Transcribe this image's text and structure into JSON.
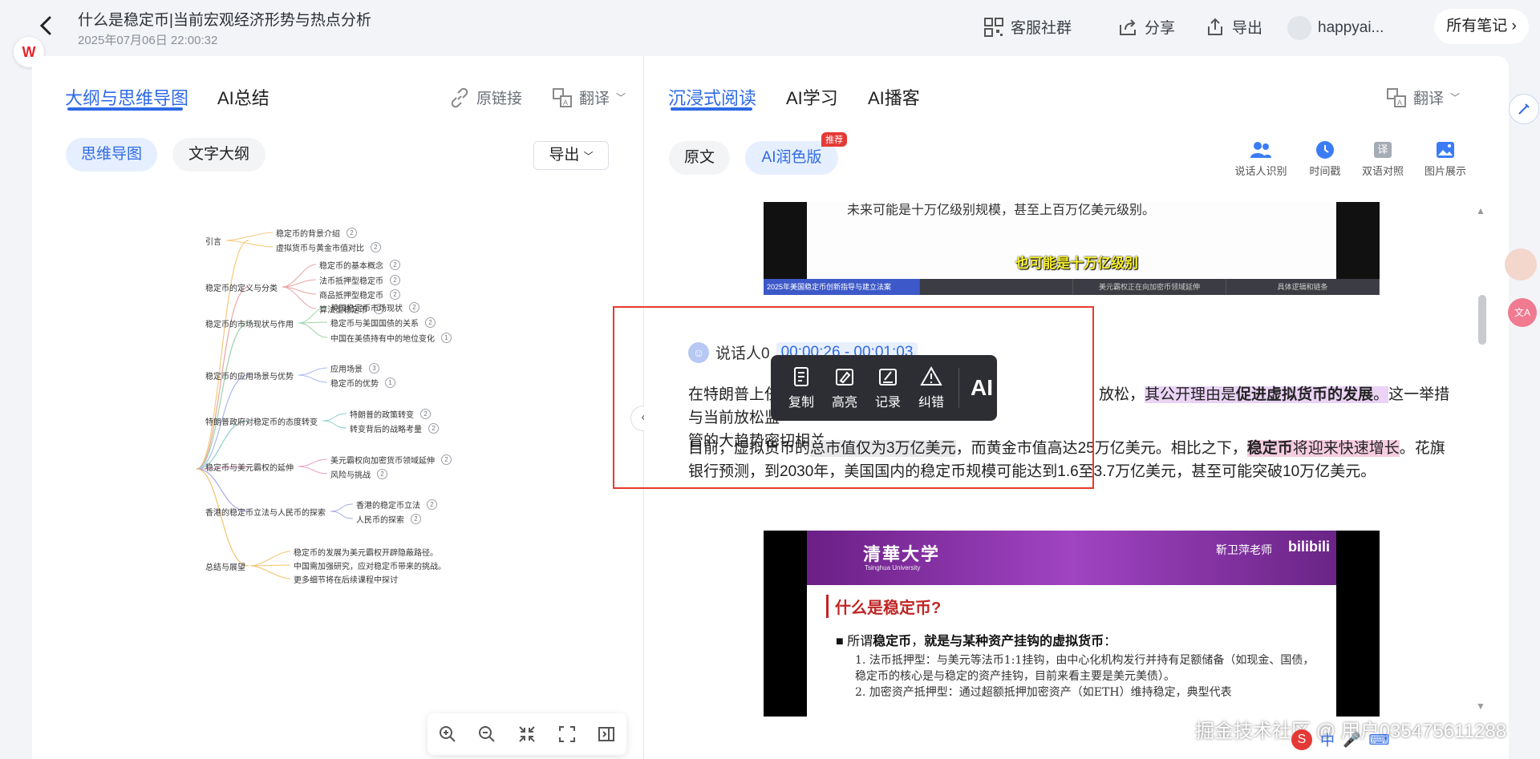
{
  "header": {
    "title": "什么是稳定币|当前宏观经济形势与热点分析",
    "date": "2025年07月06日 22:00:32",
    "service_group": "客服社群",
    "share": "分享",
    "export": "导出",
    "username": "happyai...",
    "all_notes": "所有笔记"
  },
  "left": {
    "tabs": [
      "大纲与思维导图",
      "AI总结"
    ],
    "original_link": "原链接",
    "translate": "翻译",
    "pills": [
      "思维导图",
      "文字大纲"
    ],
    "export_btn": "导出"
  },
  "mindmap": {
    "root_branches": [
      {
        "label": "引言",
        "children": [
          {
            "label": "稳定币的背景介绍",
            "n": "2"
          },
          {
            "label": "虚拟货币与黄金市值对比",
            "n": "2"
          }
        ]
      },
      {
        "label": "稳定币的定义与分类",
        "children": [
          {
            "label": "稳定币的基本概念",
            "n": "2"
          },
          {
            "label": "法币抵押型稳定币",
            "n": "2"
          },
          {
            "label": "商品抵押型稳定币",
            "n": "2"
          },
          {
            "label": "算法型稳定币",
            "n": "2"
          }
        ]
      },
      {
        "label": "稳定币的市场现状与作用",
        "children": [
          {
            "label": "美国稳定币市场现状",
            "n": "2"
          },
          {
            "label": "稳定币与美国国债的关系",
            "n": "2"
          },
          {
            "label": "中国在美债持有中的地位变化",
            "n": "1"
          }
        ]
      },
      {
        "label": "稳定币的应用场景与优势",
        "children": [
          {
            "label": "应用场景",
            "n": "3"
          },
          {
            "label": "稳定币的优势",
            "n": "1"
          }
        ]
      },
      {
        "label": "特朗普政府对稳定币的态度转变",
        "children": [
          {
            "label": "特朗普的政策转变",
            "n": "2"
          },
          {
            "label": "转变背后的战略考量",
            "n": "2"
          }
        ]
      },
      {
        "label": "稳定币与美元霸权的延伸",
        "children": [
          {
            "label": "美元霸权向加密货币领域延伸",
            "n": "2"
          },
          {
            "label": "风险与挑战",
            "n": "2"
          }
        ]
      },
      {
        "label": "香港的稳定币立法与人民币的探索",
        "children": [
          {
            "label": "香港的稳定币立法",
            "n": "2"
          },
          {
            "label": "人民币的探索",
            "n": "2"
          }
        ]
      },
      {
        "label": "总结与展望",
        "children": [
          {
            "label": "稳定币的发展为美元霸权开辟隐蔽路径。",
            "n": ""
          },
          {
            "label": "中国需加强研究，应对稳定币带来的挑战。",
            "n": ""
          },
          {
            "label": "更多细节将在后续课程中探讨",
            "n": ""
          }
        ]
      }
    ]
  },
  "right": {
    "tabs": [
      "沉浸式阅读",
      "AI学习",
      "AI播客"
    ],
    "translate": "翻译",
    "pills": [
      "原文",
      "AI润色版"
    ],
    "recommend_badge": "推荐",
    "tools": [
      "说话人识别",
      "时间戳",
      "双语对照",
      "图片展示"
    ],
    "tool_yi": "译",
    "video1": {
      "top_line": "未来可能是十万亿级别规模，甚至上百万亿美元级别。",
      "subtitle": "也可能是十万亿级别",
      "strip": [
        "2025年美国稳定币创新指导与建立法案",
        "",
        "美元霸权正在向加密币领域延伸",
        "具体逻辑和链条"
      ]
    },
    "speaker": "说话人0",
    "time_range": "00:00:26 - 00:01:03",
    "para1": {
      "a": "在特朗普上任",
      "b": "放松，",
      "c": "其公开理由是",
      "d": "促进虚拟货币的发展",
      "e": "。",
      "f": "这一举措与当前放松监",
      "g": "管的大趋势密切相关。"
    },
    "para2": {
      "a": "目前，虚拟货币的",
      "b": "总市值仅为3万亿美元",
      "c": "，而黄金市值高达25万亿美元。相比之下，",
      "d": "稳定币",
      "e": "将迎来快速增长",
      "f": "。花旗",
      "g": "银行预测，到2030年，美国国内的稳定币规模可能达到1.6至3.7万亿美元，甚至可能突破10万亿美元。"
    },
    "popup": [
      "复制",
      "高亮",
      "记录",
      "纠错"
    ],
    "popup_ai": "AI",
    "video2": {
      "university": "清華大学",
      "university_en": "Tsinghua University",
      "teacher": "靳卫萍老师",
      "bili": "bilibili",
      "slide_title": "什么是稳定币?",
      "slide_l1_pre": "■ 所谓",
      "slide_l1_b1": "稳定币",
      "slide_l1_mid": "，",
      "slide_l1_b2": "就是与某种资产挂钩的虚拟货币",
      "slide_l1_end": "：",
      "slide_l2": "1.  法币抵押型：与美元等法币1:1挂钩，由中心化机构发行并持有足额储备（如现金、国债，稳定币的核心是与稳定的资产挂钩，目前来看主要是美元美债）。",
      "slide_l3": "2.  加密资产抵押型：通过超额抵押加密资产（如ETH）维持稳定，典型代表"
    },
    "watermark": "掘金技术社区 @ 用户035475611288",
    "taskbar": "中"
  }
}
